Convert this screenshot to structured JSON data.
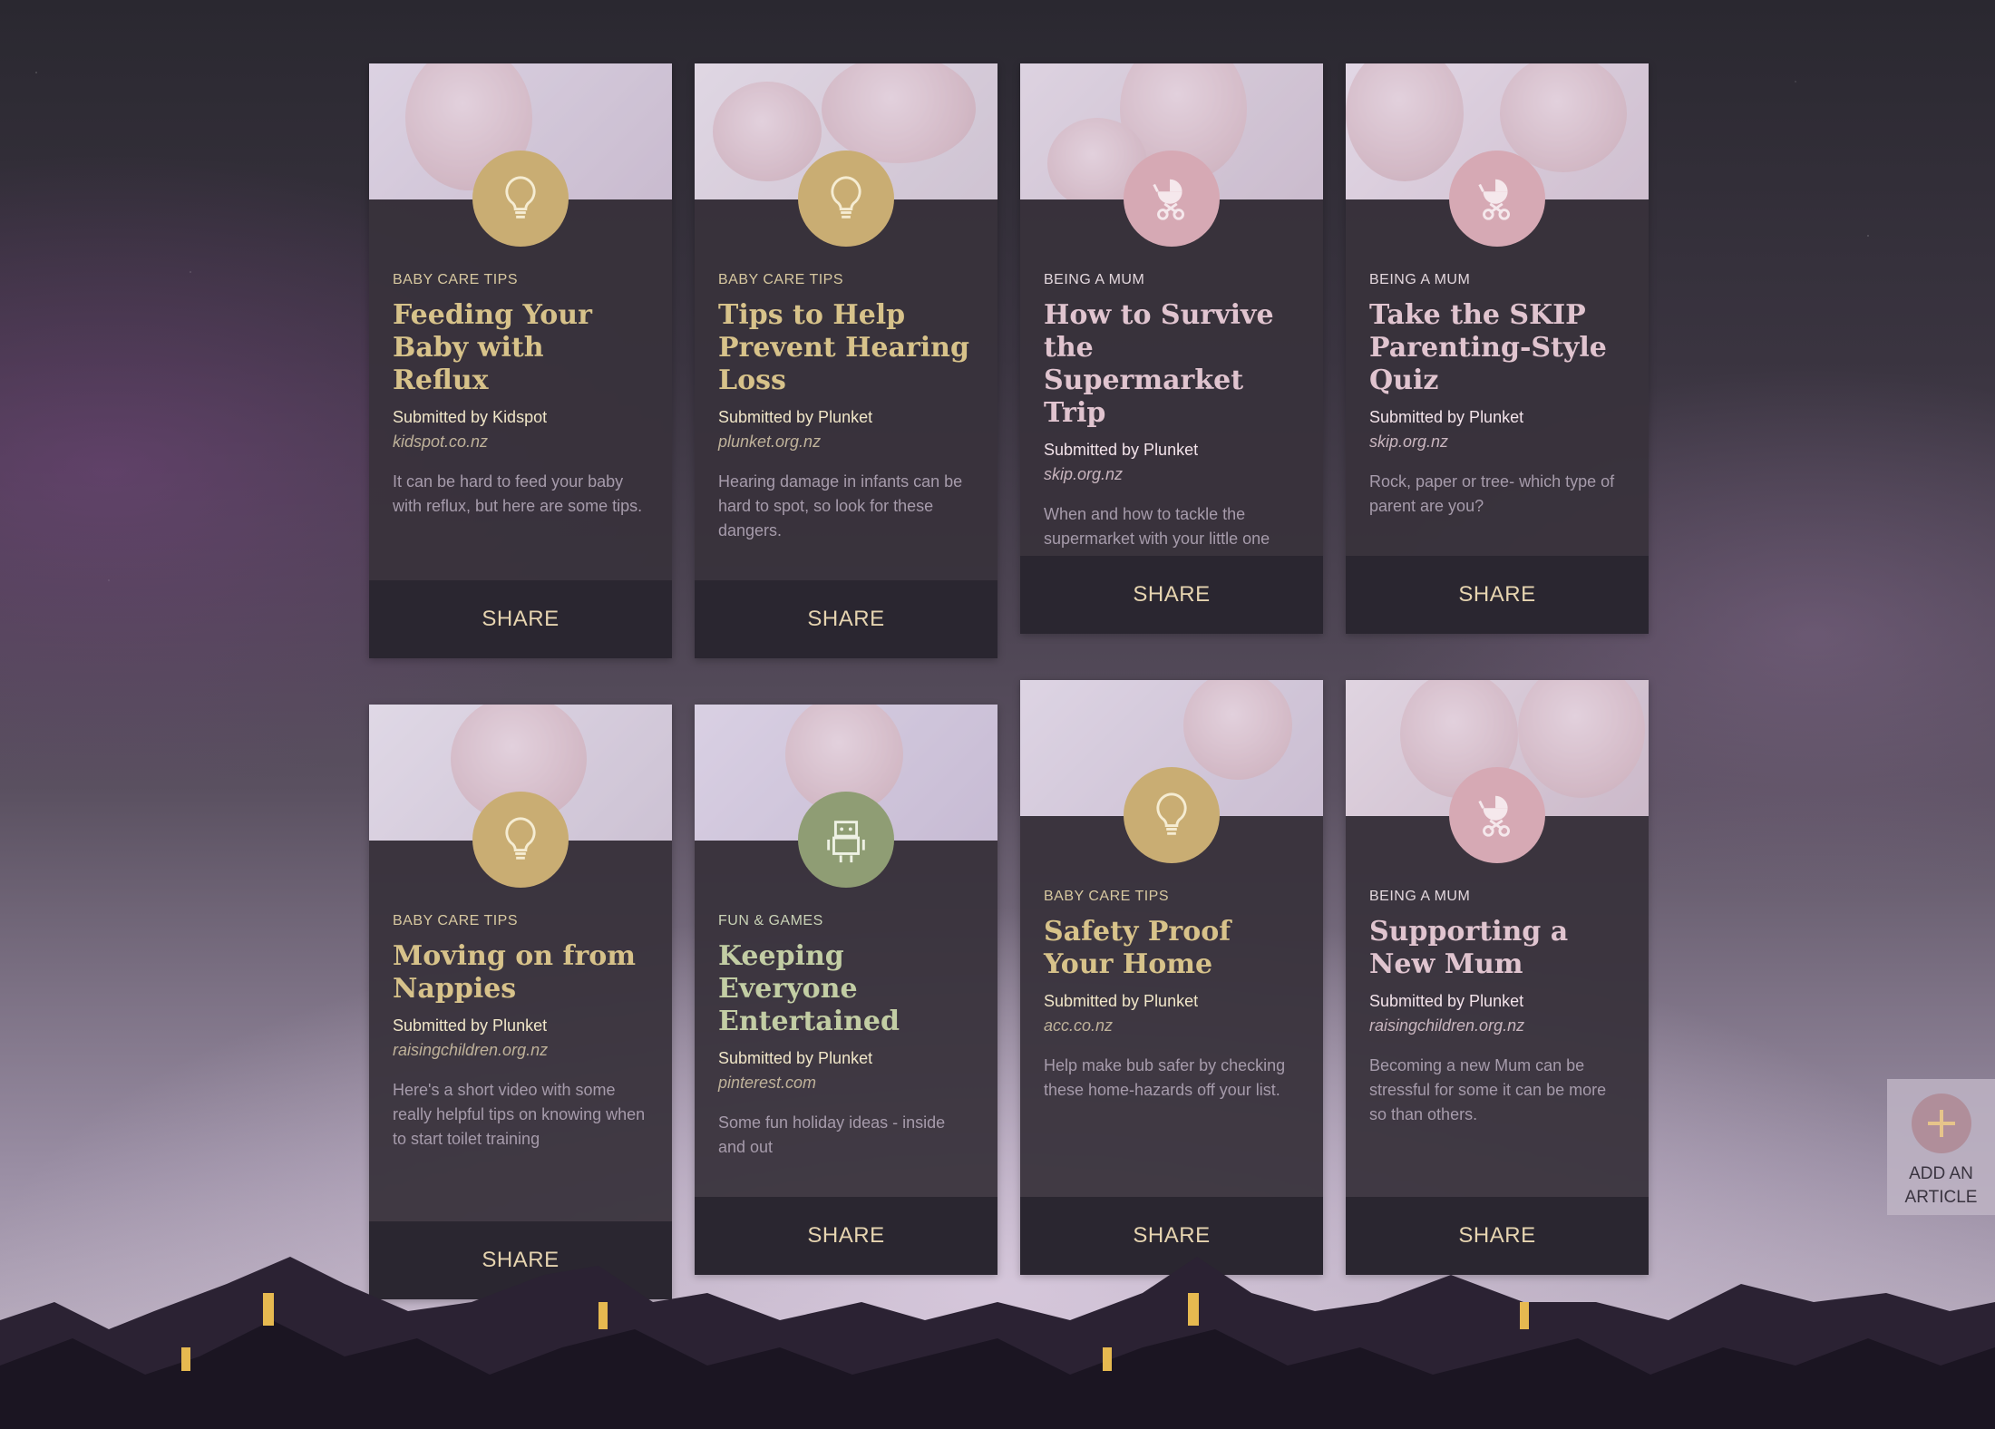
{
  "cards": [
    {
      "category": "BABY CARE TIPS",
      "title": "Feeding Your Baby with Reflux",
      "submitted": "Submitted by Kidspot",
      "source": "kidspot.co.nz",
      "description": "It can be hard to feed your baby with reflux, but here are some tips.",
      "share": "SHARE",
      "badge_icon": "lightbulb-icon"
    },
    {
      "category": "BABY CARE TIPS",
      "title": "Tips to Help Prevent Hearing Loss",
      "submitted": "Submitted by Plunket",
      "source": "plunket.org.nz",
      "description": "Hearing damage in infants can be hard to spot, so look for these dangers.",
      "share": "SHARE",
      "badge_icon": "lightbulb-icon"
    },
    {
      "category": "BEING A MUM",
      "title": "How to Survive the Supermarket Trip",
      "submitted": "Submitted by Plunket",
      "source": "skip.org.nz",
      "description": "When and how to tackle the supermarket with your little one",
      "share": "SHARE",
      "badge_icon": "pram-icon"
    },
    {
      "category": "BEING A MUM",
      "title": "Take the SKIP Parenting-Style Quiz",
      "submitted": "Submitted by Plunket",
      "source": "skip.org.nz",
      "description": "Rock, paper or tree- which type of parent are you?",
      "share": "SHARE",
      "badge_icon": "pram-icon"
    },
    {
      "category": "BABY CARE TIPS",
      "title": "Moving on from Nappies",
      "submitted": "Submitted by Plunket",
      "source": "raisingchildren.org.nz",
      "description": "Here's a short video with some really helpful tips on knowing when to start toilet training",
      "share": "SHARE",
      "badge_icon": "lightbulb-icon"
    },
    {
      "category": "FUN & GAMES",
      "title": "Keeping Everyone Entertained",
      "submitted": "Submitted by Plunket",
      "source": "pinterest.com",
      "description": "Some fun holiday ideas - inside and out",
      "share": "SHARE",
      "badge_icon": "robot-icon"
    },
    {
      "category": "BABY CARE TIPS",
      "title": "Safety Proof Your Home",
      "submitted": "Submitted by Plunket",
      "source": "acc.co.nz",
      "description": "Help make bub safer by checking these home-hazards off your list.",
      "share": "SHARE",
      "badge_icon": "lightbulb-icon"
    },
    {
      "category": "BEING A MUM",
      "title": "Supporting a New Mum",
      "submitted": "Submitted by Plunket",
      "source": "raisingchildren.org.nz",
      "description": "Becoming a new Mum can be stressful for some it can be more so than others.",
      "share": "SHARE",
      "badge_icon": "pram-icon"
    }
  ],
  "add_article": {
    "line1": "ADD AN",
    "line2": "ARTICLE",
    "icon": "plus-icon"
  },
  "colors": {
    "tips": "#c9ad73",
    "mum": "#d6a9b4",
    "fun": "#8f9d74",
    "share_bar": "#2a2630"
  }
}
